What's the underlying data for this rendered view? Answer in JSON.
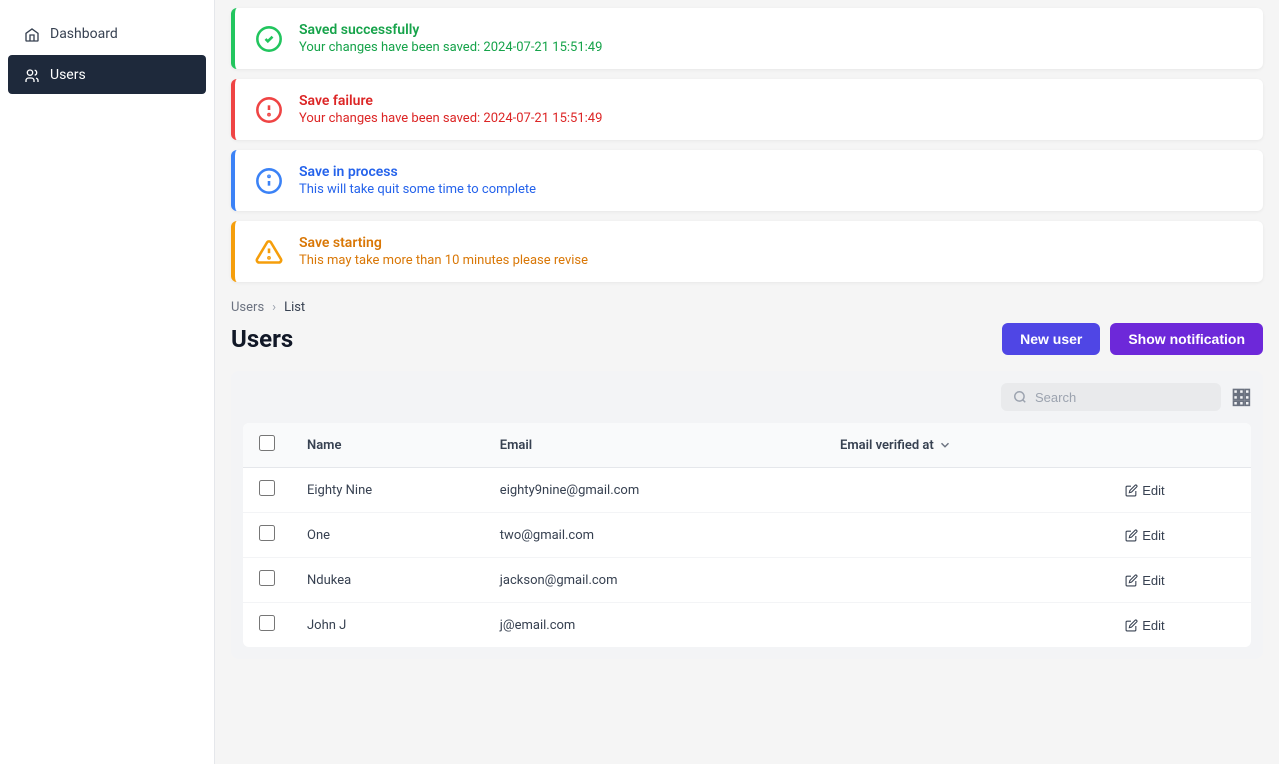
{
  "sidebar": {
    "items": [
      {
        "id": "dashboard",
        "label": "Dashboard",
        "icon": "house"
      },
      {
        "id": "users",
        "label": "Users",
        "icon": "users",
        "active": true
      }
    ]
  },
  "notifications": [
    {
      "id": "success",
      "type": "success",
      "title": "Saved successfully",
      "message": "Your changes have been saved: 2024-07-21 15:51:49"
    },
    {
      "id": "error",
      "type": "error",
      "title": "Save failure",
      "message": "Your changes have been saved: 2024-07-21 15:51:49"
    },
    {
      "id": "info",
      "type": "info",
      "title": "Save in process",
      "message": "This will take quit some time to complete"
    },
    {
      "id": "warning",
      "type": "warning",
      "title": "Save starting",
      "message": "This may take more than 10 minutes please revise"
    }
  ],
  "breadcrumb": {
    "parent": "Users",
    "separator": "›",
    "current": "List"
  },
  "page": {
    "title": "Users",
    "buttons": {
      "new_user": "New user",
      "show_notification": "Show notification"
    }
  },
  "table": {
    "search_placeholder": "Search",
    "columns": {
      "name": "Name",
      "email": "Email",
      "email_verified_at": "Email verified at"
    },
    "rows": [
      {
        "id": 1,
        "name": "Eighty Nine",
        "email": "eighty9nine@gmail.com",
        "edit_label": "Edit"
      },
      {
        "id": 2,
        "name": "One",
        "email": "two@gmail.com",
        "edit_label": "Edit"
      },
      {
        "id": 3,
        "name": "Ndukea",
        "email": "jackson@gmail.com",
        "edit_label": "Edit"
      },
      {
        "id": 4,
        "name": "John J",
        "email": "j@email.com",
        "edit_label": "Edit"
      }
    ]
  },
  "colors": {
    "success": "#22c55e",
    "error": "#ef4444",
    "info": "#3b82f6",
    "warning": "#f59e0b",
    "sidebar_active_bg": "#1e293b",
    "primary_button": "#4f46e5",
    "secondary_button": "#6d28d9"
  }
}
